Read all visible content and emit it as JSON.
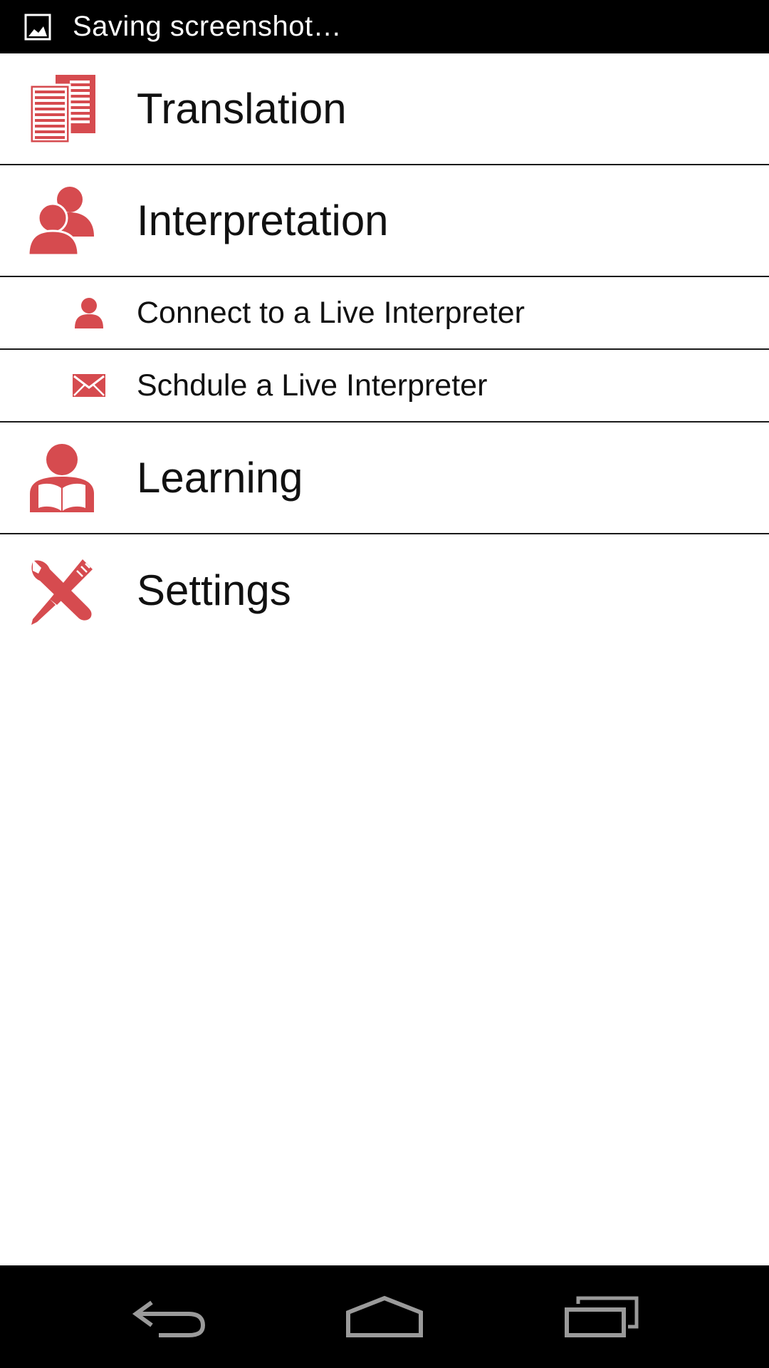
{
  "status_bar": {
    "icon": "image-icon",
    "text": "Saving screenshot…"
  },
  "menu": {
    "items": [
      {
        "id": "translation",
        "label": "Translation",
        "icon": "document-icon",
        "size": "major"
      },
      {
        "id": "interpretation",
        "label": "Interpretation",
        "icon": "people-icon",
        "size": "major"
      },
      {
        "id": "connect-live",
        "label": "Connect to a Live Interpreter",
        "icon": "person-icon",
        "size": "minor"
      },
      {
        "id": "schedule-live",
        "label": "Schdule a Live Interpreter",
        "icon": "envelope-icon",
        "size": "minor"
      },
      {
        "id": "learning",
        "label": "Learning",
        "icon": "reader-icon",
        "size": "major"
      },
      {
        "id": "settings",
        "label": "Settings",
        "icon": "tools-icon",
        "size": "major"
      }
    ]
  },
  "nav_bar": {
    "back": "back-icon",
    "home": "home-icon",
    "recents": "recents-icon"
  },
  "colors": {
    "accent": "#d64b4f",
    "status_bg": "#000000",
    "text": "#111111",
    "nav_icon": "#9a9a9a"
  }
}
